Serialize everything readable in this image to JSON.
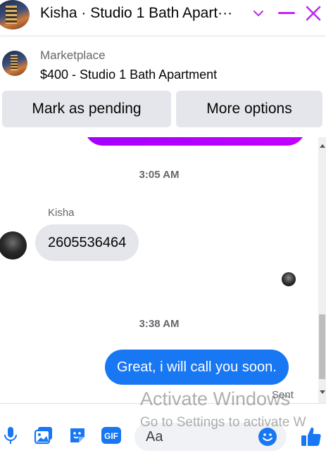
{
  "header": {
    "title": "Kisha · Studio 1 Bath Apart···",
    "chevron_icon": "chevron-down-icon",
    "minimize_icon": "minimize-icon",
    "close_icon": "close-icon",
    "accent_color": "#c026f0"
  },
  "marketplace": {
    "label": "Marketplace",
    "listing_title": "$400 - Studio 1 Bath Apartment",
    "buttons": {
      "mark_pending": "Mark as pending",
      "more_options": "More options"
    }
  },
  "conversation": {
    "timestamps": [
      "3:05 AM",
      "3:38 AM"
    ],
    "sender_name": "Kisha",
    "incoming_message": "2605536464",
    "outgoing_message": "Great, i will call you soon.",
    "status": "Sent",
    "outgoing_color": "#1877f2",
    "incoming_color": "#e4e6eb"
  },
  "composer": {
    "placeholder": "Aa",
    "icons": [
      "microphone-icon",
      "photo-icon",
      "sticker-icon",
      "gif-icon",
      "emoji-icon",
      "thumbs-up-icon"
    ],
    "gif_label": "GIF",
    "accent_color": "#1877f2"
  },
  "watermark": {
    "line1": "Activate Windows",
    "line2": "Go to Settings to activate W"
  }
}
